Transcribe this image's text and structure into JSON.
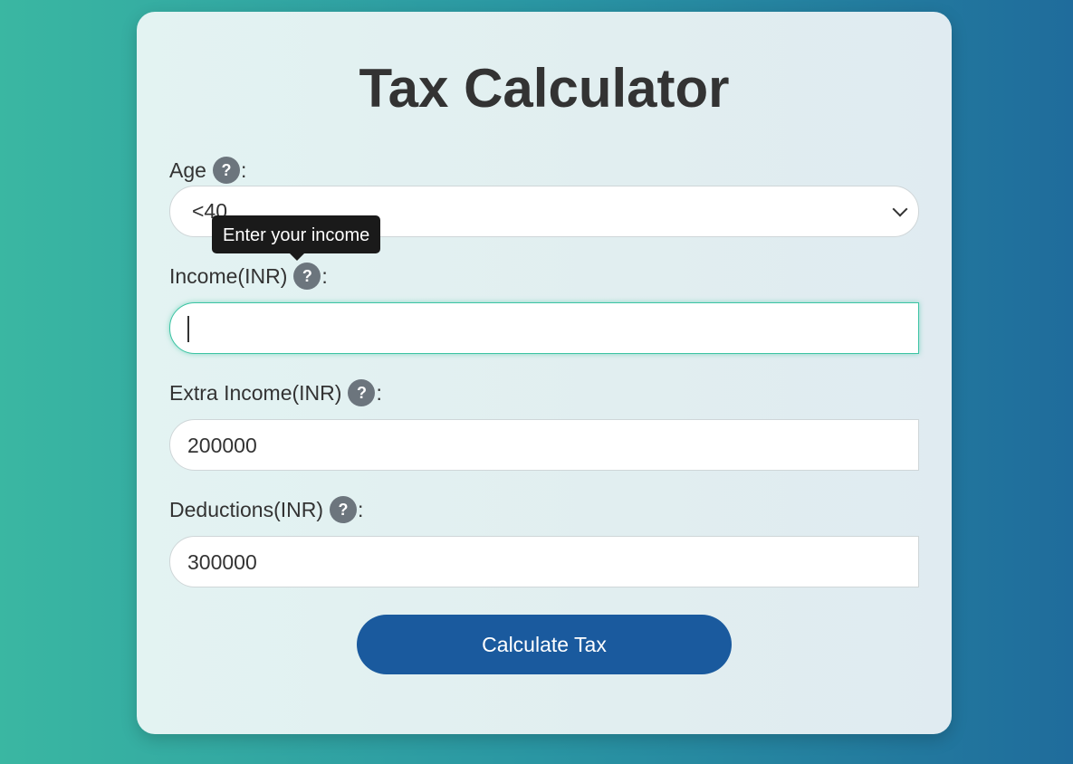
{
  "title": "Tax Calculator",
  "fields": {
    "age": {
      "label": "Age",
      "help": "?",
      "colon": ":",
      "selected": "<40"
    },
    "income": {
      "label": "Income(INR)",
      "help": "?",
      "colon": ":",
      "value": "",
      "tooltip": "Enter your income"
    },
    "extra_income": {
      "label": "Extra Income(INR)",
      "help": "?",
      "colon": ":",
      "value": "200000"
    },
    "deductions": {
      "label": "Deductions(INR)",
      "help": "?",
      "colon": ":",
      "value": "300000"
    }
  },
  "submit": {
    "label": "Calculate Tax"
  },
  "colors": {
    "accent": "#1a5a9e",
    "focus": "#3cc4a3",
    "help_icon": "#6c757d"
  },
  "icons": {
    "help": "question-mark-circle-icon",
    "select": "chevron-down-icon"
  }
}
